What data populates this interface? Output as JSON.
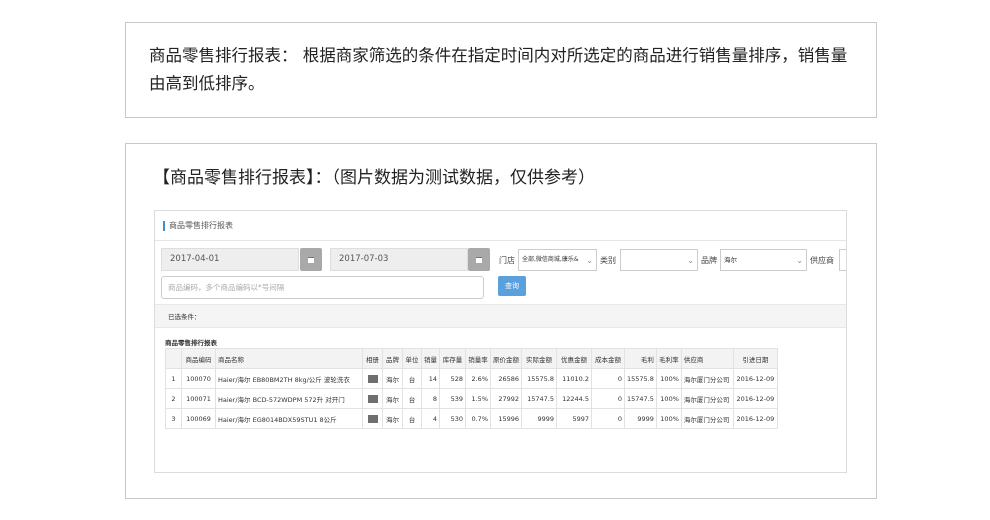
{
  "intro": {
    "text": "商品零售排行报表： 根据商家筛选的条件在指定时间内对所选定的商品进行销售量排序，销售量由高到低排序。"
  },
  "section": {
    "title": "【商品零售排行报表】：（图片数据为测试数据，仅供参考）"
  },
  "screenshot": {
    "header_title": "商品零售排行报表",
    "filters": {
      "start_date": "2017-04-01",
      "end_date": "2017-07-03",
      "store_label": "门店",
      "store_value": "全部,微信商城,康乐&",
      "category_label": "类别",
      "category_value": "",
      "brand_label": "品牌",
      "brand_value": "海尔",
      "supplier_label": "供应商",
      "search_placeholder": "商品编码，多个商品编码以*号间隔",
      "query_button": "查询"
    },
    "selected_conditions_label": "已选条件：",
    "table": {
      "title": "商品零售排行报表",
      "columns": [
        "",
        "商品编码",
        "商品名称",
        "相册",
        "品牌",
        "单位",
        "销量",
        "库存量",
        "销量率",
        "原价金额",
        "实际金额",
        "优惠金额",
        "成本金额",
        "毛利",
        "毛利率",
        "供应商",
        "引进日期"
      ],
      "rows": [
        [
          "1",
          "100070",
          "Haier/海尔 EB80BM2TH 8kg/公斤 波轮洗衣",
          "",
          "海尔",
          "台",
          "14",
          "528",
          "2.6%",
          "26586",
          "15575.8",
          "11010.2",
          "0",
          "15575.8",
          "100%",
          "海尔厦门分公司",
          "2016-12-09"
        ],
        [
          "2",
          "100071",
          "Haier/海尔 BCD-572WDPM 572升 对开门",
          "",
          "海尔",
          "台",
          "8",
          "539",
          "1.5%",
          "27992",
          "15747.5",
          "12244.5",
          "0",
          "15747.5",
          "100%",
          "海尔厦门分公司",
          "2016-12-09"
        ],
        [
          "3",
          "100069",
          "Haier/海尔 EG8014BDX59STU1 8公斤",
          "",
          "海尔",
          "台",
          "4",
          "530",
          "0.7%",
          "15996",
          "9999",
          "5997",
          "0",
          "9999",
          "100%",
          "海尔厦门分公司",
          "2016-12-09"
        ]
      ]
    }
  }
}
